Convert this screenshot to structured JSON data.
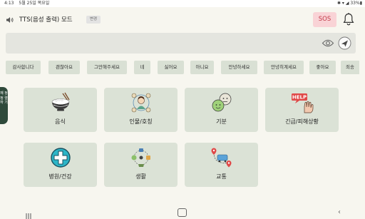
{
  "status_bar": {
    "time": "4:13",
    "date": "5월 25일 목요일",
    "right": "✱ ▾ ◢ 33%▮"
  },
  "header": {
    "speaker_icon": "speaker-icon",
    "title": "TTS(음성 출력) 모드",
    "change_label": "변경",
    "sos_label": "SOS",
    "bell_icon": "bell-icon"
  },
  "input": {
    "text": "",
    "eye_icon": "eye-icon",
    "send_icon": "send-icon"
  },
  "phrases": [
    "감사합니다",
    "괜찮아요",
    "그만해주세요",
    "네",
    "싫어요",
    "아니요",
    "안녕하세요",
    "안녕히계세요",
    "좋아요",
    "죄송"
  ],
  "side_tab": {
    "label": "재 정 정 렬 하 기"
  },
  "categories": [
    {
      "label": "음식",
      "icon": "rice-bowl-icon"
    },
    {
      "label": "인물/호칭",
      "icon": "person-network-icon"
    },
    {
      "label": "기분",
      "icon": "emotion-faces-icon"
    },
    {
      "label": "긴급/피해상황",
      "icon": "help-hand-icon",
      "badge": "HELP"
    },
    {
      "label": "병원/건강",
      "icon": "medical-cross-icon"
    },
    {
      "label": "생활",
      "icon": "daily-life-icon"
    },
    {
      "label": "교통",
      "icon": "transport-route-icon"
    }
  ],
  "colors": {
    "background": "#f7f6ef",
    "card": "#dbe2d6",
    "chip": "#d9e0d4",
    "sos_bg": "#f9d3d6",
    "sos_text": "#c23a48",
    "side_tab": "#2f4a3b"
  }
}
